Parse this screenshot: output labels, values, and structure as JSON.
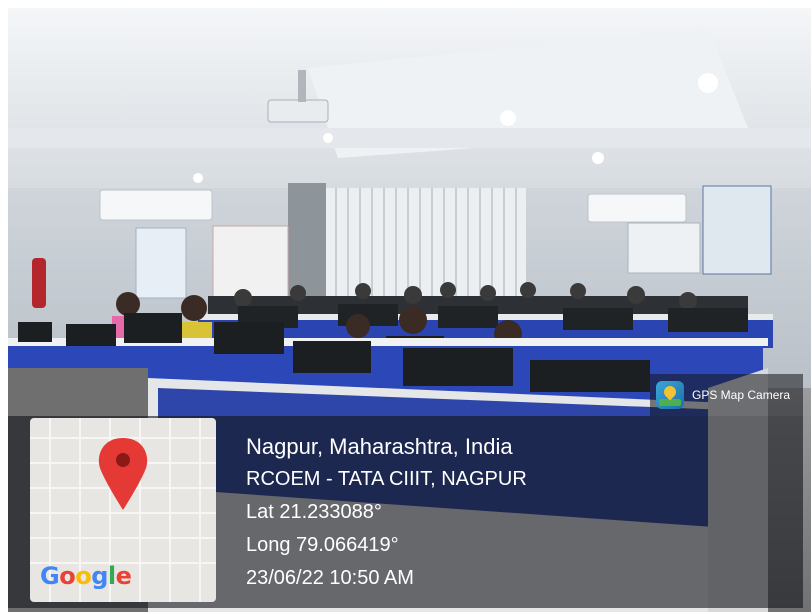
{
  "overlay": {
    "badge": {
      "label": "GPS Map Camera",
      "icon": "gps-map-camera-icon"
    },
    "location": {
      "place": "Nagpur, Maharashtra, India",
      "venue": "RCOEM - TATA CIIIT, NAGPUR",
      "latitude": "Lat 21.233088°",
      "longitude": "Long 79.066419°",
      "datetime": "23/06/22 10:50 AM"
    },
    "map": {
      "pin_icon": "map-pin-icon",
      "logo_letters": [
        "G",
        "o",
        "o",
        "g",
        "l",
        "e"
      ],
      "logo_colors": [
        "#4285F4",
        "#EA4335",
        "#FBBC05",
        "#4285F4",
        "#34A853",
        "#EA4335"
      ],
      "pin_color": "#e53935"
    }
  }
}
